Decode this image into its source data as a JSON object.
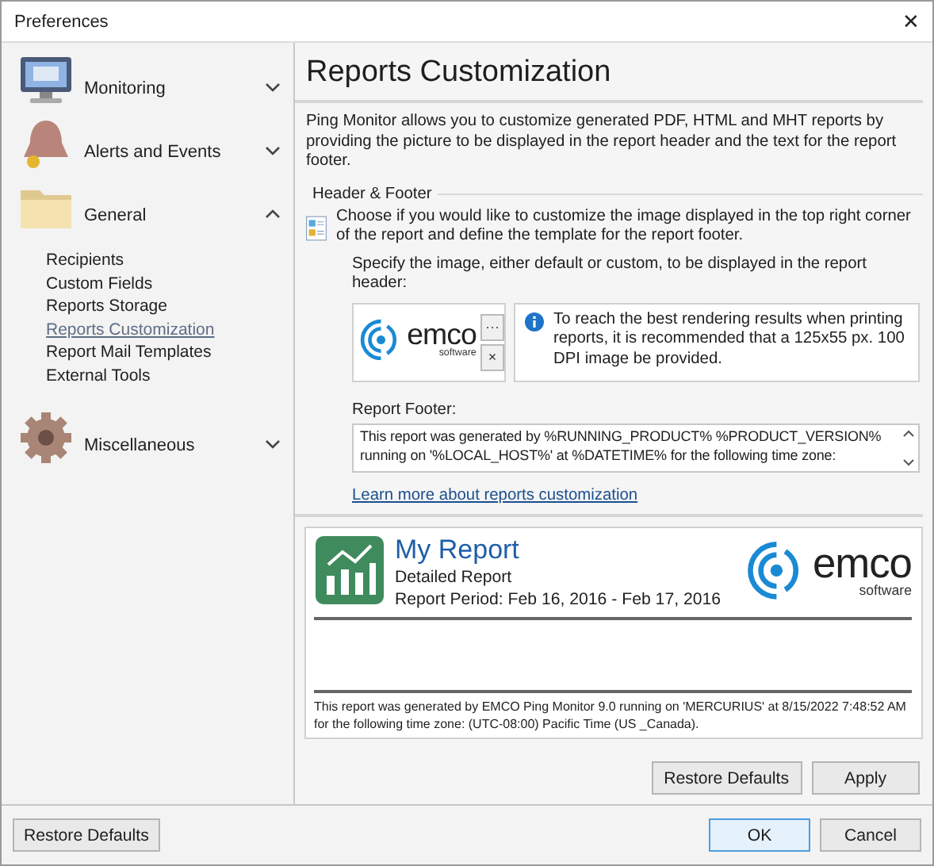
{
  "window": {
    "title": "Preferences",
    "close": "✕"
  },
  "sidebar": {
    "groups": [
      {
        "label": "Monitoring",
        "kind": "monitor",
        "expanded": false
      },
      {
        "label": "Alerts and Events",
        "kind": "bell",
        "expanded": false
      },
      {
        "label": "General",
        "kind": "folder",
        "expanded": true,
        "items": [
          {
            "label": "Recipients",
            "selected": false
          },
          {
            "label": "Custom Fields",
            "selected": false
          },
          {
            "label": "Reports Storage",
            "selected": false
          },
          {
            "label": "Reports Customization",
            "selected": true
          },
          {
            "label": "Report Mail Templates",
            "selected": false
          },
          {
            "label": "External Tools",
            "selected": false
          }
        ]
      },
      {
        "label": "Miscellaneous",
        "kind": "gear",
        "expanded": false
      }
    ]
  },
  "content": {
    "title": "Reports Customization",
    "description": "Ping Monitor allows you to customize generated PDF, HTML and MHT reports by providing the picture to be displayed in the report header and the text for the report footer.",
    "section": "Header & Footer",
    "section_text": "Choose if you would like to customize the image displayed in the top right corner of the report and define the template for the report footer.",
    "image_label": "Specify the image, either default or custom, to be displayed in the report header:",
    "logo": {
      "name": "emco",
      "sub": "software"
    },
    "browse_button": "···",
    "clear_button": "×",
    "info": "To reach the best rendering results when printing reports, it is recommended that a 125x55 px. 100 DPI image be provided.",
    "footer_label": "Report Footer:",
    "footer_value": "This report was generated by %RUNNING_PRODUCT% %PRODUCT_VERSION%\nrunning on '%LOCAL_HOST%' at %DATETIME% for the following time zone:",
    "link": "Learn more about reports customization",
    "preview": {
      "title": "My Report",
      "subtitle": "Detailed Report",
      "period": "Report Period: Feb 16, 2016 - Feb 17, 2016",
      "logo": {
        "name": "emco",
        "sub": "software"
      },
      "footer": "This report was generated by EMCO Ping Monitor 9.0 running on 'MERCURIUS' at 8/15/2022 7:48:52 AM for the following time zone: (UTC-08:00) Pacific Time (US _Canada)."
    },
    "buttons": [
      "Restore Defaults",
      "Apply"
    ]
  },
  "footer": {
    "left_button": "Restore Defaults",
    "buttons": [
      {
        "label": "OK",
        "default": true
      },
      {
        "label": "Cancel",
        "default": false
      }
    ]
  }
}
